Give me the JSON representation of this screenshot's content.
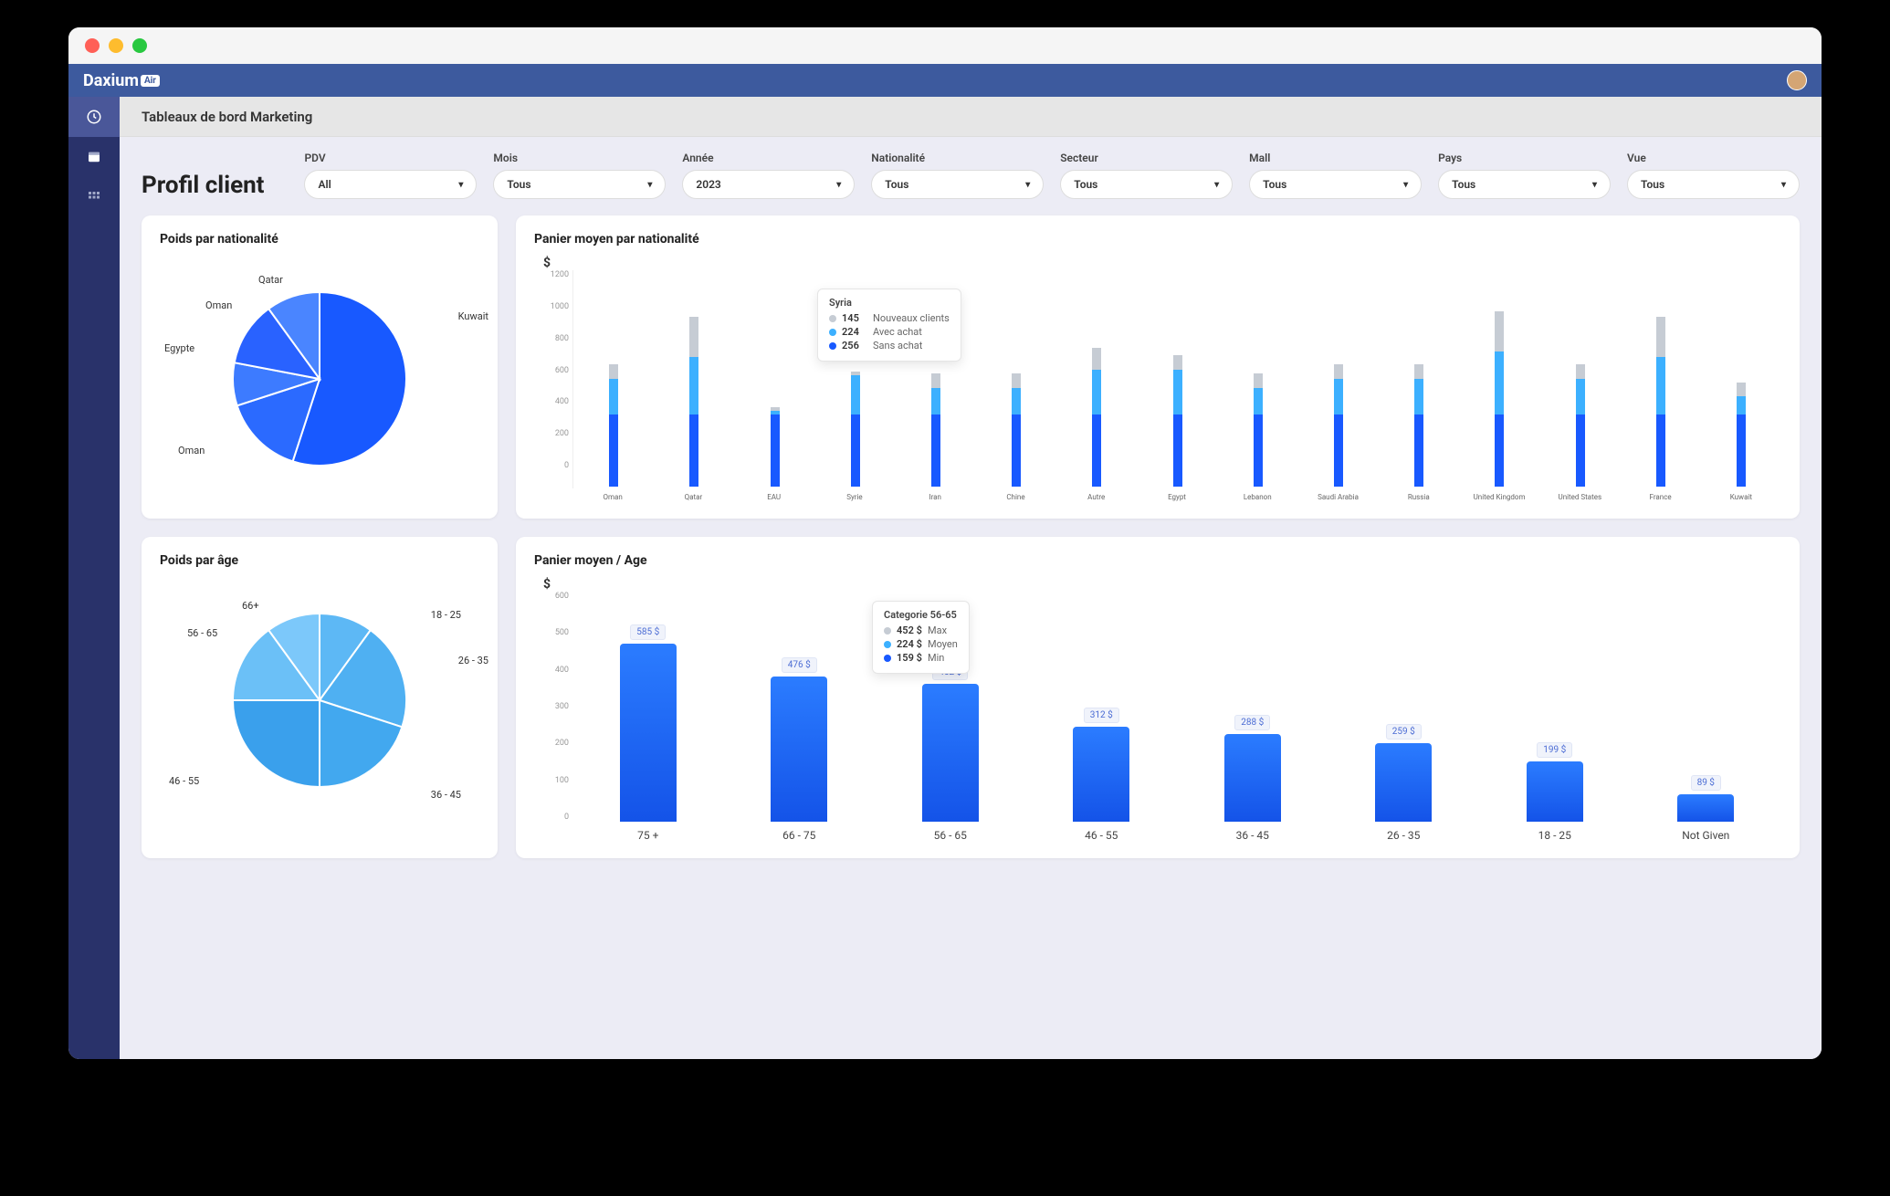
{
  "brand": {
    "name": "Daxium",
    "tag": "Air"
  },
  "page_header": "Tableaux de bord Marketing",
  "page_title": "Profil client",
  "filters": [
    {
      "label": "PDV",
      "value": "All"
    },
    {
      "label": "Mois",
      "value": "Tous"
    },
    {
      "label": "Année",
      "value": "2023"
    },
    {
      "label": "Nationalité",
      "value": "Tous"
    },
    {
      "label": "Secteur",
      "value": "Tous"
    },
    {
      "label": "Mall",
      "value": "Tous"
    },
    {
      "label": "Pays",
      "value": "Tous"
    },
    {
      "label": "Vue",
      "value": "Tous"
    }
  ],
  "cards": {
    "pie1": {
      "title": "Poids par nationalité"
    },
    "bar1": {
      "title": "Panier moyen par nationalité",
      "ylabel": "$"
    },
    "pie2": {
      "title": "Poids par âge"
    },
    "bar2": {
      "title": "Panier moyen / Age",
      "ylabel": "$"
    }
  },
  "tooltip1": {
    "title": "Syria",
    "rows": [
      {
        "val": "145",
        "label": "Nouveaux clients",
        "color": "#c6ccd4"
      },
      {
        "val": "224",
        "label": "Avec achat",
        "color": "#3cb0ff"
      },
      {
        "val": "256",
        "label": "Sans achat",
        "color": "#1859ff"
      }
    ]
  },
  "tooltip2": {
    "title": "Categorie 56-65",
    "rows": [
      {
        "val": "452 $",
        "label": "Max",
        "color": "#c6ccd4"
      },
      {
        "val": "224 $",
        "label": "Moyen",
        "color": "#3cb0ff"
      },
      {
        "val": "159  $",
        "label": "Min",
        "color": "#1859ff"
      }
    ]
  },
  "chart_data": [
    {
      "type": "pie",
      "title": "Poids par nationalité",
      "categories": [
        "Kuwait",
        "Oman",
        "Egypte",
        "Oman",
        "Qatar"
      ],
      "values": [
        55,
        15,
        8,
        12,
        10
      ]
    },
    {
      "type": "bar",
      "title": "Panier moyen par nationalité",
      "ylabel": "$",
      "ylim": [
        0,
        1200
      ],
      "yticks": [
        0,
        200,
        400,
        600,
        800,
        1000,
        1200
      ],
      "categories": [
        "Oman",
        "Qatar",
        "EAU",
        "Syrie",
        "Iran",
        "Chine",
        "Autre",
        "Egypt",
        "Lebanon",
        "Saudi Arabia",
        "Russia",
        "United Kingdom",
        "United States",
        "France",
        "Kuwait"
      ],
      "series": [
        {
          "name": "Sans achat",
          "color": "#1859ff",
          "values": [
            400,
            400,
            400,
            400,
            400,
            400,
            400,
            400,
            400,
            400,
            400,
            400,
            400,
            400,
            400
          ]
        },
        {
          "name": "Avec achat",
          "color": "#3cb0ff",
          "values": [
            200,
            320,
            20,
            220,
            150,
            150,
            250,
            250,
            150,
            200,
            200,
            350,
            200,
            320,
            100
          ]
        },
        {
          "name": "Nouveaux clients",
          "color": "#c6ccd4",
          "values": [
            80,
            220,
            20,
            20,
            80,
            80,
            120,
            80,
            80,
            80,
            80,
            220,
            80,
            220,
            80
          ]
        }
      ]
    },
    {
      "type": "pie",
      "title": "Poids par âge",
      "categories": [
        "18 - 25",
        "26 - 35",
        "36 - 45",
        "46 - 55",
        "56 - 65",
        "66+"
      ],
      "values": [
        10,
        20,
        20,
        25,
        15,
        10
      ]
    },
    {
      "type": "bar",
      "title": "Panier moyen / Age",
      "ylabel": "$",
      "ylim": [
        0,
        600
      ],
      "yticks": [
        0,
        100,
        200,
        300,
        400,
        500,
        600
      ],
      "categories": [
        "75 +",
        "66 - 75",
        "56 - 65",
        "46 - 55",
        "36 - 45",
        "26 - 35",
        "18 - 25",
        "Not Given"
      ],
      "values": [
        585,
        476,
        452,
        312,
        288,
        259,
        199,
        89
      ],
      "labels": [
        "585 $",
        "476 $",
        "452 $",
        "312 $",
        "288 $",
        "259 $",
        "199 $",
        "89 $"
      ]
    }
  ]
}
